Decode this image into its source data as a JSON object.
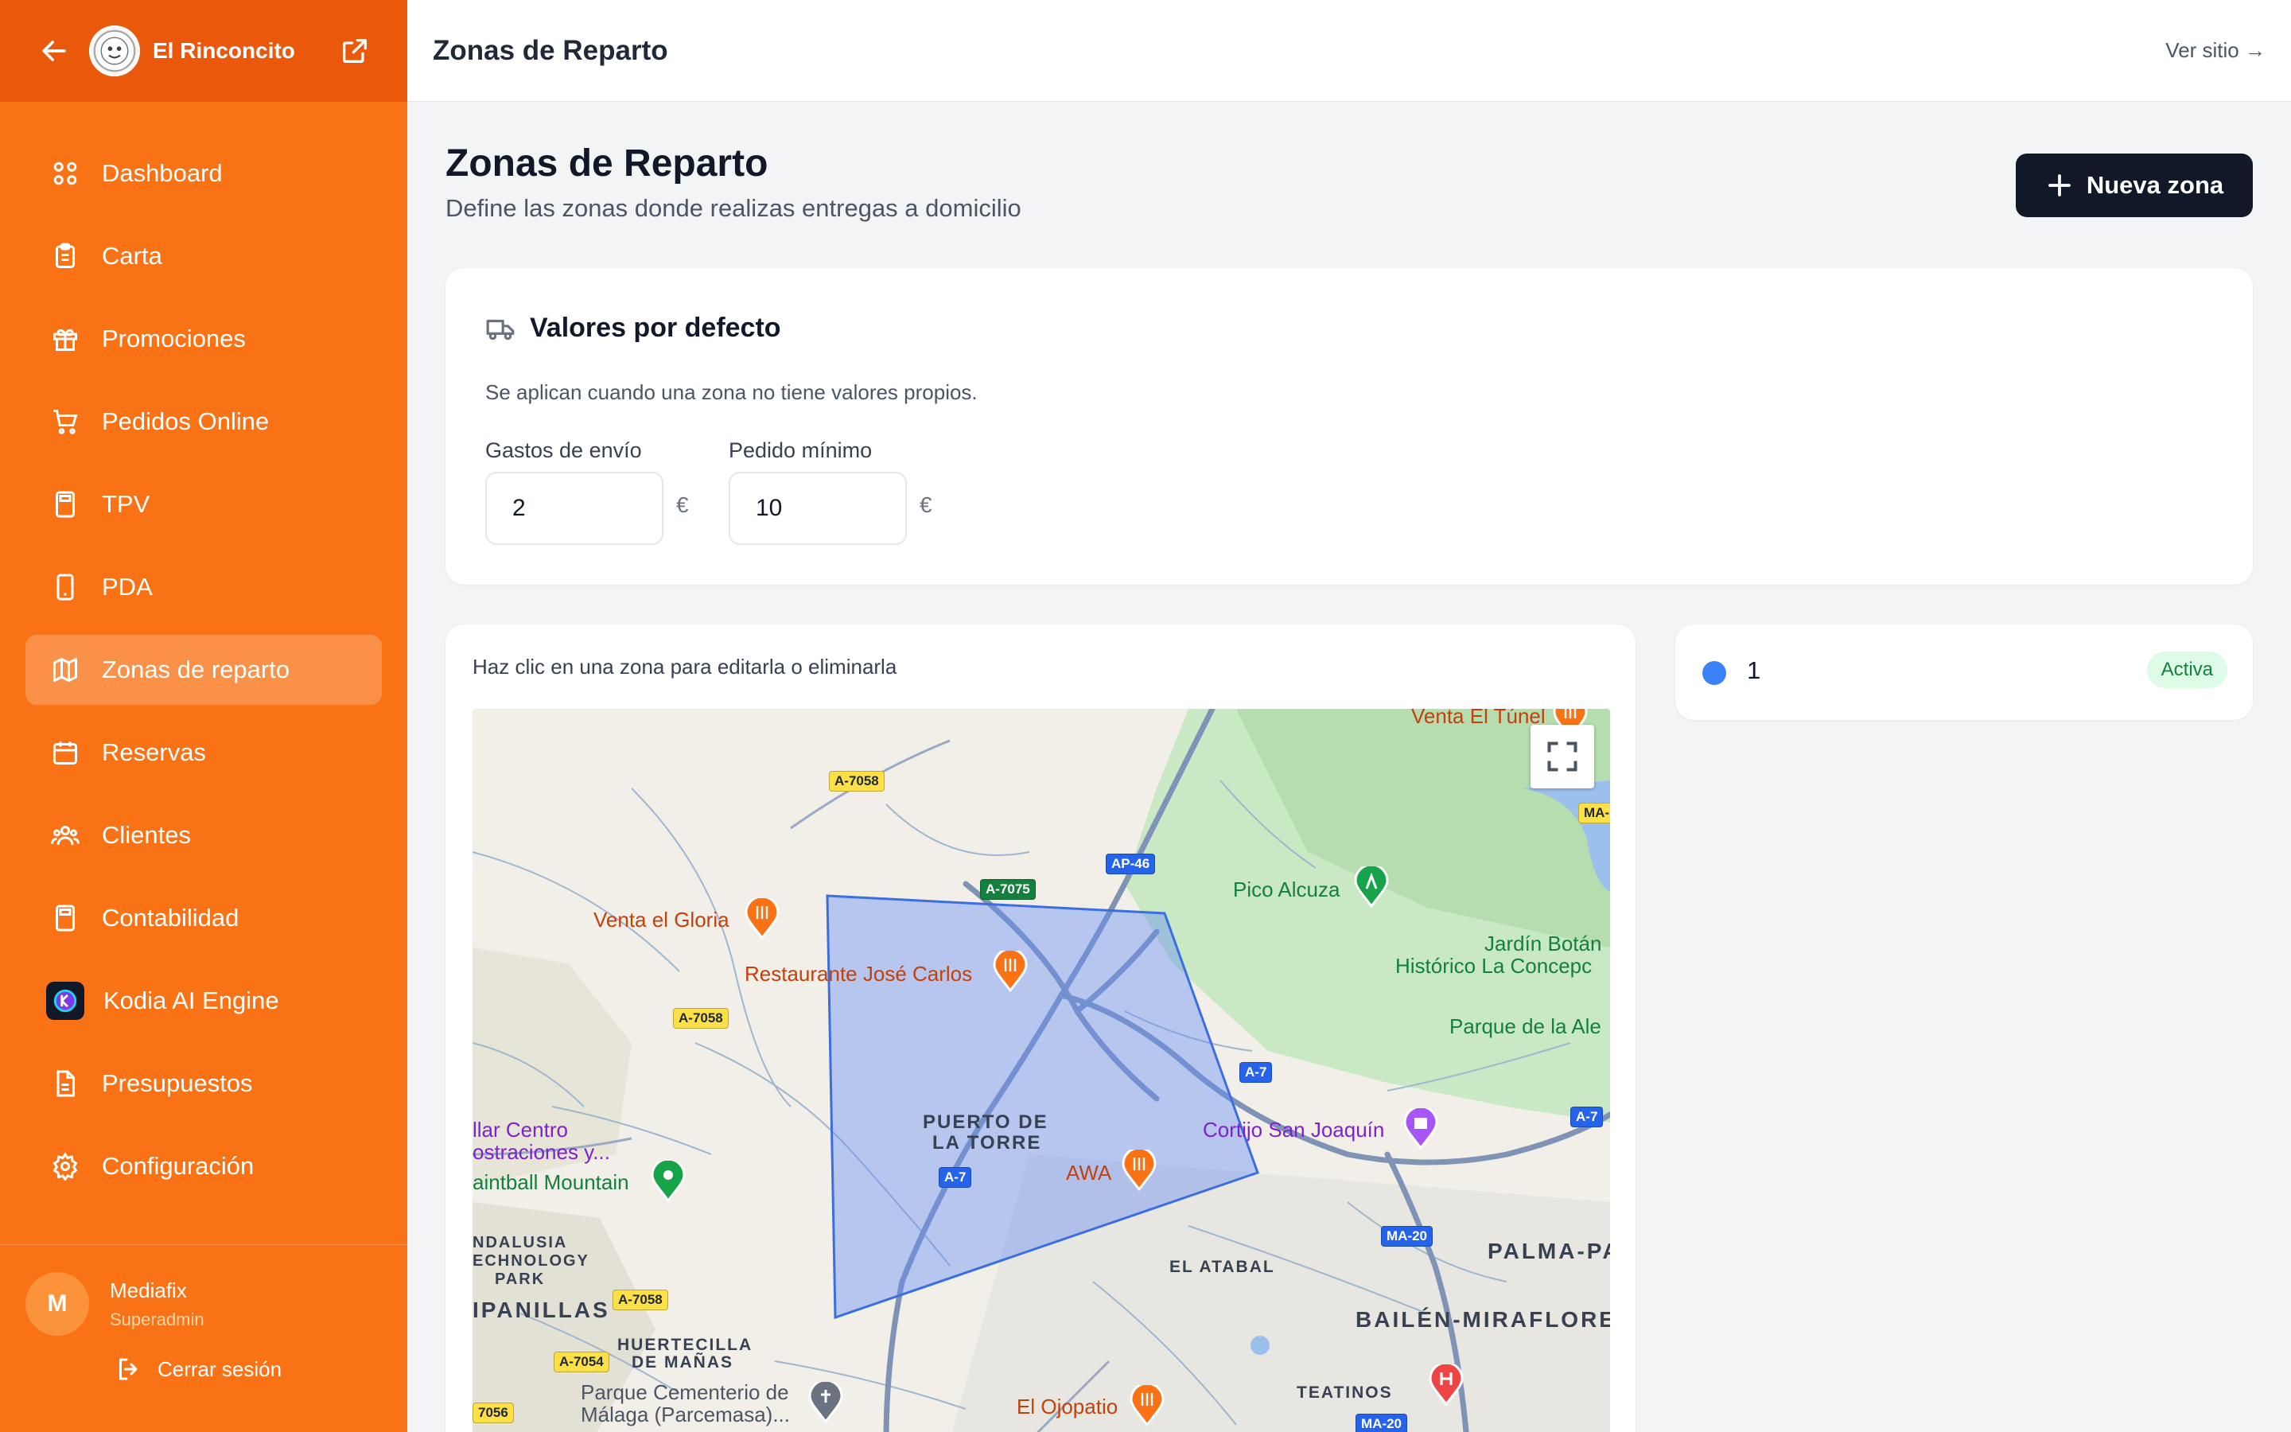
{
  "brand": {
    "name": "El Rinconcito"
  },
  "topbar": {
    "title": "Zonas de Reparto",
    "site_link": "Ver sitio →"
  },
  "nav": {
    "items": [
      {
        "label": "Dashboard",
        "icon": "grid-icon"
      },
      {
        "label": "Carta",
        "icon": "clipboard-icon"
      },
      {
        "label": "Promociones",
        "icon": "gift-icon"
      },
      {
        "label": "Pedidos Online",
        "icon": "cart-icon"
      },
      {
        "label": "TPV",
        "icon": "calculator-icon"
      },
      {
        "label": "PDA",
        "icon": "phone-icon"
      },
      {
        "label": "Zonas de reparto",
        "icon": "map-icon",
        "active": true
      },
      {
        "label": "Reservas",
        "icon": "calendar-icon"
      },
      {
        "label": "Clientes",
        "icon": "users-icon"
      },
      {
        "label": "Contabilidad",
        "icon": "calculator-icon"
      },
      {
        "label": "Kodia AI Engine",
        "icon": "kodia-logo-icon"
      },
      {
        "label": "Presupuestos",
        "icon": "document-icon"
      },
      {
        "label": "Configuración",
        "icon": "gear-icon"
      }
    ]
  },
  "user": {
    "initial": "M",
    "name": "Mediafix",
    "role": "Superadmin",
    "logout_label": "Cerrar sesión"
  },
  "page": {
    "title": "Zonas de Reparto",
    "subtitle": "Define las zonas donde realizas entregas a domicilio",
    "new_zone_label": "Nueva zona"
  },
  "defaults": {
    "title": "Valores por defecto",
    "description": "Se aplican cuando una zona no tiene valores propios.",
    "shipping_label": "Gastos de envío",
    "shipping_value": "2",
    "min_order_label": "Pedido mínimo",
    "min_order_value": "10",
    "currency": "€"
  },
  "map": {
    "hint": "Haz clic en una zona para editarla o eliminarla",
    "labels": {
      "venta_tunel": "Venta El Túnel",
      "pico_alcuza": "Pico Alcuza",
      "jardin1": "Jardín Botán",
      "jardin2": "Histórico La Concepc",
      "parque_de_la": "Parque de la Ale",
      "venta_gloria": "Venta el Gloria",
      "restaurante": "Restaurante José Carlos",
      "puerto1": "PUERTO DE",
      "puerto2": "LA TORRE",
      "awa": "AWA",
      "cortijo": "Cortijo San Joaquín",
      "villar1": "llar Centro",
      "villar2": "ostraciones y...",
      "paintball": "aintball Mountain",
      "andalusia1": "NDALUSIA",
      "andalusia2": "ECHNOLOGY",
      "andalusia3": "PARK",
      "campanillas": "IPANILLAS",
      "huertecilla1": "HUERTECILLA",
      "huertecilla2": "DE MAÑAS",
      "cementerio1": "Parque Cementerio de",
      "cementerio2": "Málaga (Parcemasa)...",
      "el_atabal": "EL ATABAL",
      "palma": "PALMA-PA",
      "bailen": "BAILÉN-MIRAFLORES",
      "teatinos": "TEATINOS",
      "ojopatio": "El Ojopatio"
    },
    "roads": {
      "a7058_top": "A-7058",
      "a7075": "A-7075",
      "ap46": "AP-46",
      "ma_top": "MA-",
      "a7058_mid": "A-7058",
      "a7_right": "A-7",
      "a7_center": "A-7",
      "a7_far": "A-7",
      "ma20_mid": "MA-20",
      "a7058_low": "A-7058",
      "a7054": "A-7054",
      "road_7056": "7056",
      "ma20_bottom": "MA-20"
    }
  },
  "zones": [
    {
      "name": "1",
      "status": "Activa",
      "color": "#3b82f6"
    }
  ]
}
